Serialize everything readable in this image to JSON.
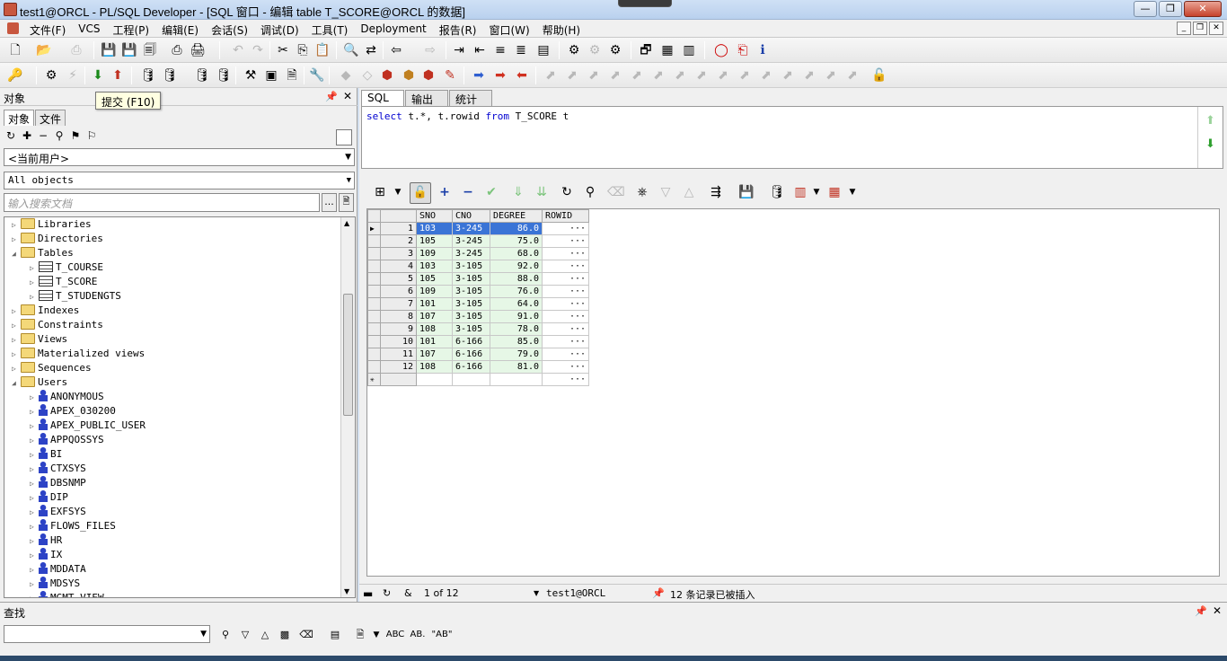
{
  "window": {
    "title": "test1@ORCL - PL/SQL Developer - [SQL 窗口 - 编辑 table T_SCORE@ORCL 的数据]",
    "minimize": "—",
    "maximize": "❐",
    "close": "✕"
  },
  "menu": {
    "items": [
      "文件(F)",
      "VCS",
      "工程(P)",
      "编辑(E)",
      "会话(S)",
      "调试(D)",
      "工具(T)",
      "Deployment",
      "报告(R)",
      "窗口(W)",
      "帮助(H)"
    ]
  },
  "tooltip": "提交 (F10)",
  "left_panel": {
    "title": "对象",
    "tabs": [
      "对象",
      "文件"
    ],
    "user_combo": "<当前用户>",
    "type_combo": "All objects",
    "search_placeholder": "输入搜索文档",
    "search_dots": "...",
    "tree": [
      {
        "label": "Libraries",
        "level": 0,
        "icon": "folder-icon",
        "expanded": false
      },
      {
        "label": "Directories",
        "level": 0,
        "icon": "folder-icon",
        "expanded": false
      },
      {
        "label": "Tables",
        "level": 0,
        "icon": "folder-open-icon",
        "expanded": true
      },
      {
        "label": "T_COURSE",
        "level": 1,
        "icon": "table-icon",
        "expanded": false
      },
      {
        "label": "T_SCORE",
        "level": 1,
        "icon": "table-icon",
        "expanded": false
      },
      {
        "label": "T_STUDENGTS",
        "level": 1,
        "icon": "table-icon",
        "expanded": false
      },
      {
        "label": "Indexes",
        "level": 0,
        "icon": "folder-icon",
        "expanded": false
      },
      {
        "label": "Constraints",
        "level": 0,
        "icon": "folder-icon",
        "expanded": false
      },
      {
        "label": "Views",
        "level": 0,
        "icon": "folder-icon",
        "expanded": false
      },
      {
        "label": "Materialized views",
        "level": 0,
        "icon": "folder-icon",
        "expanded": false
      },
      {
        "label": "Sequences",
        "level": 0,
        "icon": "folder-icon",
        "expanded": false
      },
      {
        "label": "Users",
        "level": 0,
        "icon": "folder-open-icon",
        "expanded": true
      },
      {
        "label": "ANONYMOUS",
        "level": 1,
        "icon": "user-icon",
        "expanded": false
      },
      {
        "label": "APEX_030200",
        "level": 1,
        "icon": "user-icon",
        "expanded": false
      },
      {
        "label": "APEX_PUBLIC_USER",
        "level": 1,
        "icon": "user-icon",
        "expanded": false
      },
      {
        "label": "APPQOSSYS",
        "level": 1,
        "icon": "user-icon",
        "expanded": false
      },
      {
        "label": "BI",
        "level": 1,
        "icon": "user-icon",
        "expanded": false
      },
      {
        "label": "CTXSYS",
        "level": 1,
        "icon": "user-icon",
        "expanded": false
      },
      {
        "label": "DBSNMP",
        "level": 1,
        "icon": "user-icon",
        "expanded": false
      },
      {
        "label": "DIP",
        "level": 1,
        "icon": "user-icon",
        "expanded": false
      },
      {
        "label": "EXFSYS",
        "level": 1,
        "icon": "user-icon",
        "expanded": false
      },
      {
        "label": "FLOWS_FILES",
        "level": 1,
        "icon": "user-icon",
        "expanded": false
      },
      {
        "label": "HR",
        "level": 1,
        "icon": "user-icon",
        "expanded": false
      },
      {
        "label": "IX",
        "level": 1,
        "icon": "user-icon",
        "expanded": false
      },
      {
        "label": "MDDATA",
        "level": 1,
        "icon": "user-icon",
        "expanded": false
      },
      {
        "label": "MDSYS",
        "level": 1,
        "icon": "user-icon",
        "expanded": false
      },
      {
        "label": "MGMT_VIEW",
        "level": 1,
        "icon": "user-icon",
        "expanded": false
      }
    ]
  },
  "editor": {
    "tabs": [
      "SQL",
      "输出",
      "统计"
    ],
    "sql": {
      "kw1": "select",
      "p1": " t.*, t.rowid ",
      "kw2": "from",
      "p2": " T_SCORE t"
    },
    "grid": {
      "columns": [
        "SNO",
        "CNO",
        "DEGREE",
        "ROWID"
      ],
      "rows": [
        [
          "1",
          "103",
          "3-245",
          "86.0"
        ],
        [
          "2",
          "105",
          "3-245",
          "75.0"
        ],
        [
          "3",
          "109",
          "3-245",
          "68.0"
        ],
        [
          "4",
          "103",
          "3-105",
          "92.0"
        ],
        [
          "5",
          "105",
          "3-105",
          "88.0"
        ],
        [
          "6",
          "109",
          "3-105",
          "76.0"
        ],
        [
          "7",
          "101",
          "3-105",
          "64.0"
        ],
        [
          "8",
          "107",
          "3-105",
          "91.0"
        ],
        [
          "9",
          "108",
          "3-105",
          "78.0"
        ],
        [
          "10",
          "101",
          "6-166",
          "85.0"
        ],
        [
          "11",
          "107",
          "6-166",
          "79.0"
        ],
        [
          "12",
          "108",
          "6-166",
          "81.0"
        ]
      ],
      "rowid_button": "···",
      "new_row_marker": "✳",
      "selected_row": 0
    },
    "status": {
      "position": "1 of 12",
      "connection": "test1@ORCL",
      "message": "12 条记录已被插入"
    }
  },
  "find_panel": {
    "title": "查找",
    "labels": {
      "abc": "ABC",
      "ab_box": "AB.",
      "ab_quote": "\"AB\""
    }
  },
  "colors": {
    "selection": "#3a74d6",
    "changed_cell": "#e6f7e6",
    "keyword": "#0000d0"
  }
}
